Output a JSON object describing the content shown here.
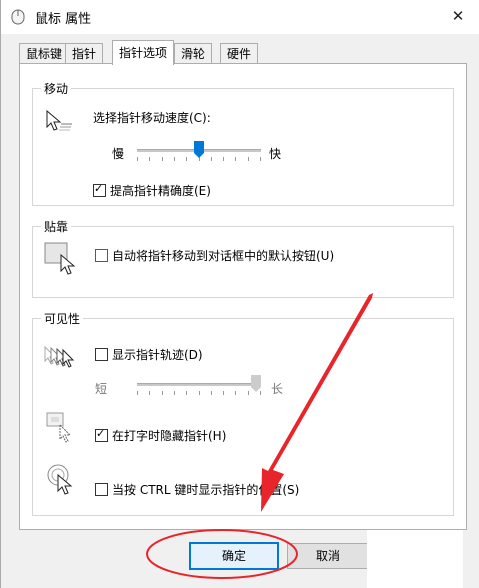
{
  "window": {
    "title": "鼠标 属性",
    "close_glyph": "✕"
  },
  "tabs": [
    {
      "label": "鼠标键",
      "active": false
    },
    {
      "label": "指针",
      "active": false
    },
    {
      "label": "指针选项",
      "active": true
    },
    {
      "label": "滑轮",
      "active": false
    },
    {
      "label": "硬件",
      "active": false
    }
  ],
  "motion": {
    "title": "移动",
    "speed_label": "选择指针移动速度(C):",
    "slow_label": "慢",
    "fast_label": "快",
    "speed_level": 0.5,
    "precision_label": "提高指针精确度(E)",
    "precision_checked": true
  },
  "snap": {
    "title": "贴靠",
    "snap_label": "自动将指针移动到对话框中的默认按钮(U)",
    "snap_checked": false
  },
  "visibility": {
    "title": "可见性",
    "trails_label": "显示指针轨迹(D)",
    "trails_checked": false,
    "short_label": "短",
    "long_label": "长",
    "trails_level": 1.0,
    "hide_label": "在打字时隐藏指针(H)",
    "hide_checked": true,
    "ctrl_label": "当按 CTRL 键时显示指针的位置(S)",
    "ctrl_checked": false
  },
  "buttons": {
    "ok_label": "确定",
    "cancel_label": "取消"
  },
  "colors": {
    "accent": "#0078d7",
    "annotation": "#e8252a"
  }
}
